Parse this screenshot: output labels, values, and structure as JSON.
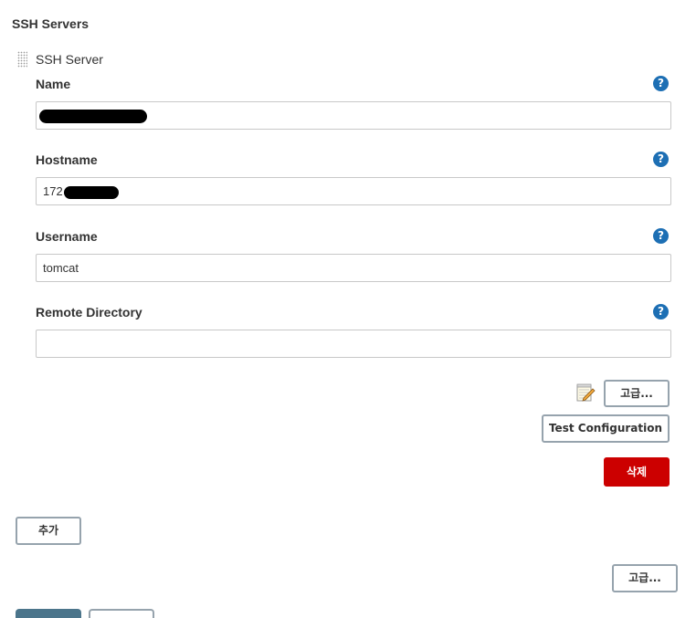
{
  "section": {
    "title": "SSH Servers"
  },
  "server": {
    "label": "SSH Server",
    "fields": {
      "name": {
        "label": "Name",
        "value": ""
      },
      "hostname": {
        "label": "Hostname",
        "value_prefix": "172"
      },
      "username": {
        "label": "Username",
        "value": "tomcat"
      },
      "remote_directory": {
        "label": "Remote Directory",
        "value": ""
      }
    },
    "help_glyph": "?",
    "advanced_label": "고급...",
    "test_configuration_label": "Test Configuration",
    "delete_label": "삭제"
  },
  "footer": {
    "add_label": "추가",
    "advanced_label": "고급..."
  },
  "colors": {
    "help_icon": "#1d6fb4",
    "delete_button": "#cc0000",
    "button_border": "#96a3ad",
    "field_border": "#c8c8c8",
    "primary_stub": "#4b758b"
  },
  "icons": {
    "drag_handle": "drag-handle-icon",
    "help": "help-icon",
    "notepad": "notepad-pencil-icon"
  }
}
